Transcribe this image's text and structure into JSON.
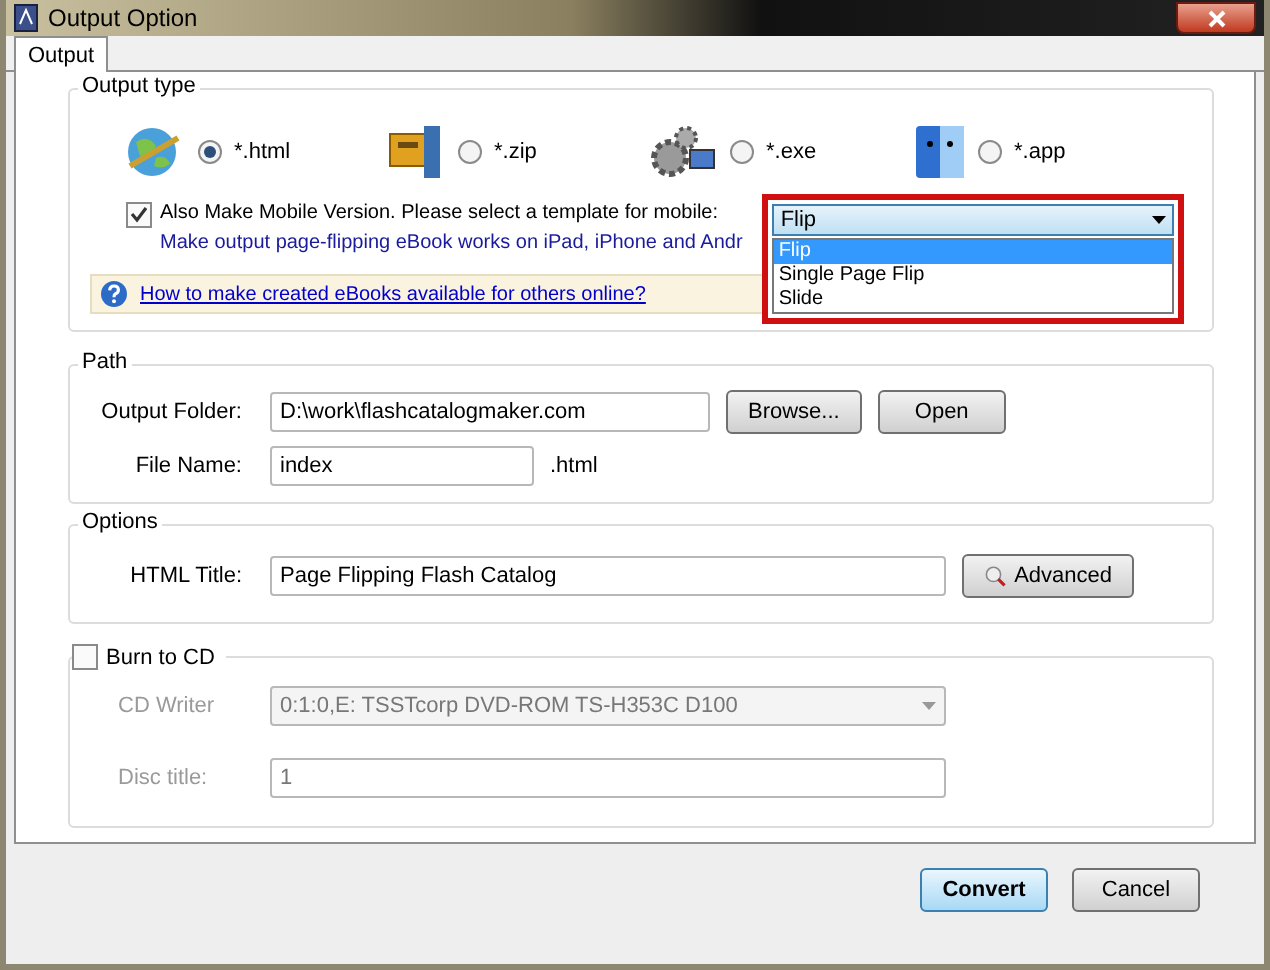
{
  "window": {
    "title": "Output Option"
  },
  "tabs": [
    {
      "label": "Output",
      "selected": true
    }
  ],
  "output_type": {
    "title": "Output type",
    "formats": [
      {
        "label": "*.html",
        "selected": true,
        "kind": "globe"
      },
      {
        "label": "*.zip",
        "selected": false,
        "kind": "archive"
      },
      {
        "label": "*.exe",
        "selected": false,
        "kind": "gears"
      },
      {
        "label": "*.app",
        "selected": false,
        "kind": "mac"
      }
    ],
    "mobile": {
      "label": "Also Make Mobile Version. Please select a template for mobile:",
      "checked": true,
      "note": "Make output page-flipping eBook works on iPad, iPhone and Andr",
      "template": "Flip",
      "options": [
        {
          "label": "Flip",
          "selected": true
        },
        {
          "label": "Single Page Flip",
          "selected": false
        },
        {
          "label": "Slide",
          "selected": false
        }
      ]
    },
    "help_link": "How to make created eBooks available for others online?"
  },
  "path": {
    "title": "Path",
    "output_folder_label": "Output Folder:",
    "output_folder": "D:\\work\\flashcatalogmaker.com",
    "browse": "Browse...",
    "open": "Open",
    "file_name_label": "File Name:",
    "file_name": "index",
    "extension": ".html"
  },
  "options": {
    "title": "Options",
    "html_title_label": "HTML Title:",
    "html_title": "Page Flipping Flash Catalog",
    "advanced": "Advanced"
  },
  "burn_to_cd": {
    "label": "Burn to CD",
    "checked": false,
    "fields": [
      {
        "kind": "select",
        "label": "CD Writer",
        "value": "0:1:0,E: TSSTcorp DVD-ROM TS-H353C D100"
      },
      {
        "kind": "text",
        "label": "Disc title:",
        "value": "1"
      }
    ]
  },
  "buttons": [
    {
      "label": "Convert",
      "default": true
    },
    {
      "label": "Cancel",
      "default": false
    }
  ]
}
